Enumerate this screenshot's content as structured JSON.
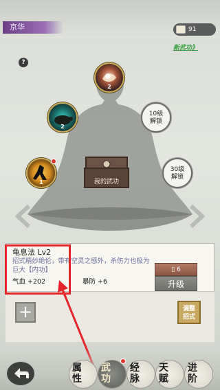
{
  "header": {
    "location": "京华",
    "currency_value": "91",
    "new_skill_link": "新武功》"
  },
  "slots": {
    "top_level": "2",
    "left_level": "2",
    "bottom_left_level": "1",
    "locked_10": "10级\n解锁",
    "locked_30": "30级\n解锁"
  },
  "center": {
    "chest_label": "我的武功"
  },
  "skill": {
    "name": "龟息法  Lv2",
    "description": "招式精妙绝伦，带有空灵之感外，杀伤力也极为巨大【内功】",
    "stat1": "气血 +202",
    "stat2": "暴防 +6",
    "upgrade_cost": "6",
    "upgrade_label": "升级",
    "adjust_label": "调整\n招式"
  },
  "nav": {
    "tab1": "属\n性",
    "tab2": "武\n功",
    "tab3": "经\n脉",
    "tab4": "天\n赋",
    "tab5": "进\n阶"
  },
  "colors": {
    "accent_gold": "#c9a955",
    "highlight_red": "#e4262b",
    "link_green": "#3aa043",
    "location_purple": "#6b3f86"
  }
}
